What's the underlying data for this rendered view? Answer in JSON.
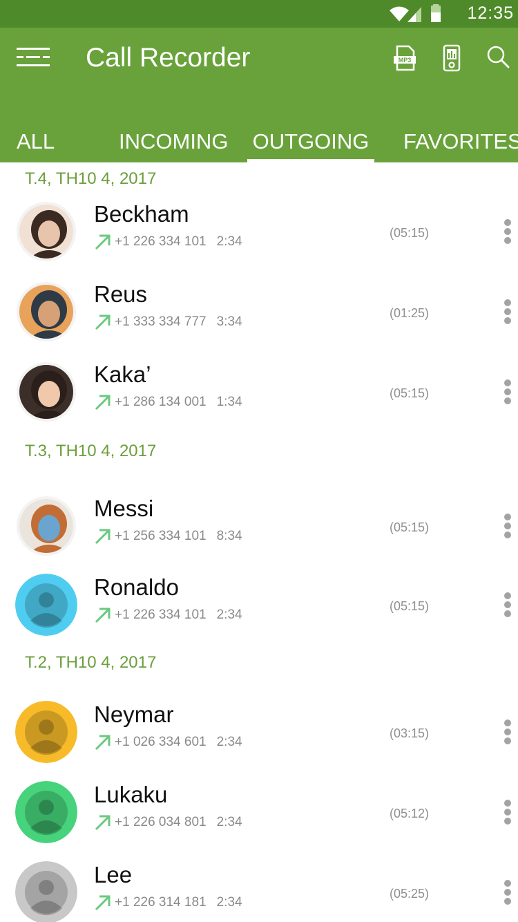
{
  "status_bar": {
    "time": "12:35"
  },
  "app_bar": {
    "title": "Call Recorder",
    "color": "#69a23a",
    "status_color": "#4f8a2a",
    "actions": [
      "menu-icon",
      "mp3-icon",
      "player-icon",
      "search-icon"
    ],
    "mp3_label": "MP3"
  },
  "tabs": [
    {
      "label": "ALL",
      "selected": false
    },
    {
      "label": "INCOMING",
      "selected": false
    },
    {
      "label": "OUTGOING",
      "selected": true
    },
    {
      "label": "FAVORITES",
      "selected": false
    }
  ],
  "groups": [
    {
      "date": "T.4, TH10 4, 2017",
      "calls": [
        {
          "name": "Beckham",
          "number": "+1 226 334 101",
          "time": "2:34",
          "duration": "(05:15)",
          "avatar": "photo",
          "avatar_color": "#d9b7a2"
        },
        {
          "name": "Reus",
          "number": "+1 333 334 777",
          "time": "3:34",
          "duration": "(01:25)",
          "avatar": "photo",
          "avatar_color": "#c98a52"
        },
        {
          "name": "Kaka’",
          "number": "+1 286 134 001",
          "time": "1:34",
          "duration": "(05:15)",
          "avatar": "photo",
          "avatar_color": "#8e6c5a"
        }
      ]
    },
    {
      "date": "T.3, TH10 4, 2017",
      "calls": [
        {
          "name": "Messi",
          "number": "+1 256 334 101",
          "time": "8:34",
          "duration": "(05:15)",
          "avatar": "photo",
          "avatar_color": "#d8c4a8"
        },
        {
          "name": "Ronaldo",
          "number": "+1 226 334 101",
          "time": "2:34",
          "duration": "(05:15)",
          "avatar": "default",
          "avatar_color": "#4fcdf0"
        }
      ]
    },
    {
      "date": "T.2, TH10 4, 2017",
      "calls": [
        {
          "name": "Neymar",
          "number": "+1 026 334 601",
          "time": "2:34",
          "duration": "(03:15)",
          "avatar": "default",
          "avatar_color": "#f7bb2a"
        },
        {
          "name": "Lukaku",
          "number": "+1 226 034 801",
          "time": "2:34",
          "duration": "(05:12)",
          "avatar": "default",
          "avatar_color": "#46d37b"
        },
        {
          "name": "Lee",
          "number": "+1 226 314 181",
          "time": "2:34",
          "duration": "(05:25)",
          "avatar": "default",
          "avatar_color": "#c8c8c8"
        }
      ]
    }
  ],
  "outgoing_arrow_color": "#6ac97f"
}
